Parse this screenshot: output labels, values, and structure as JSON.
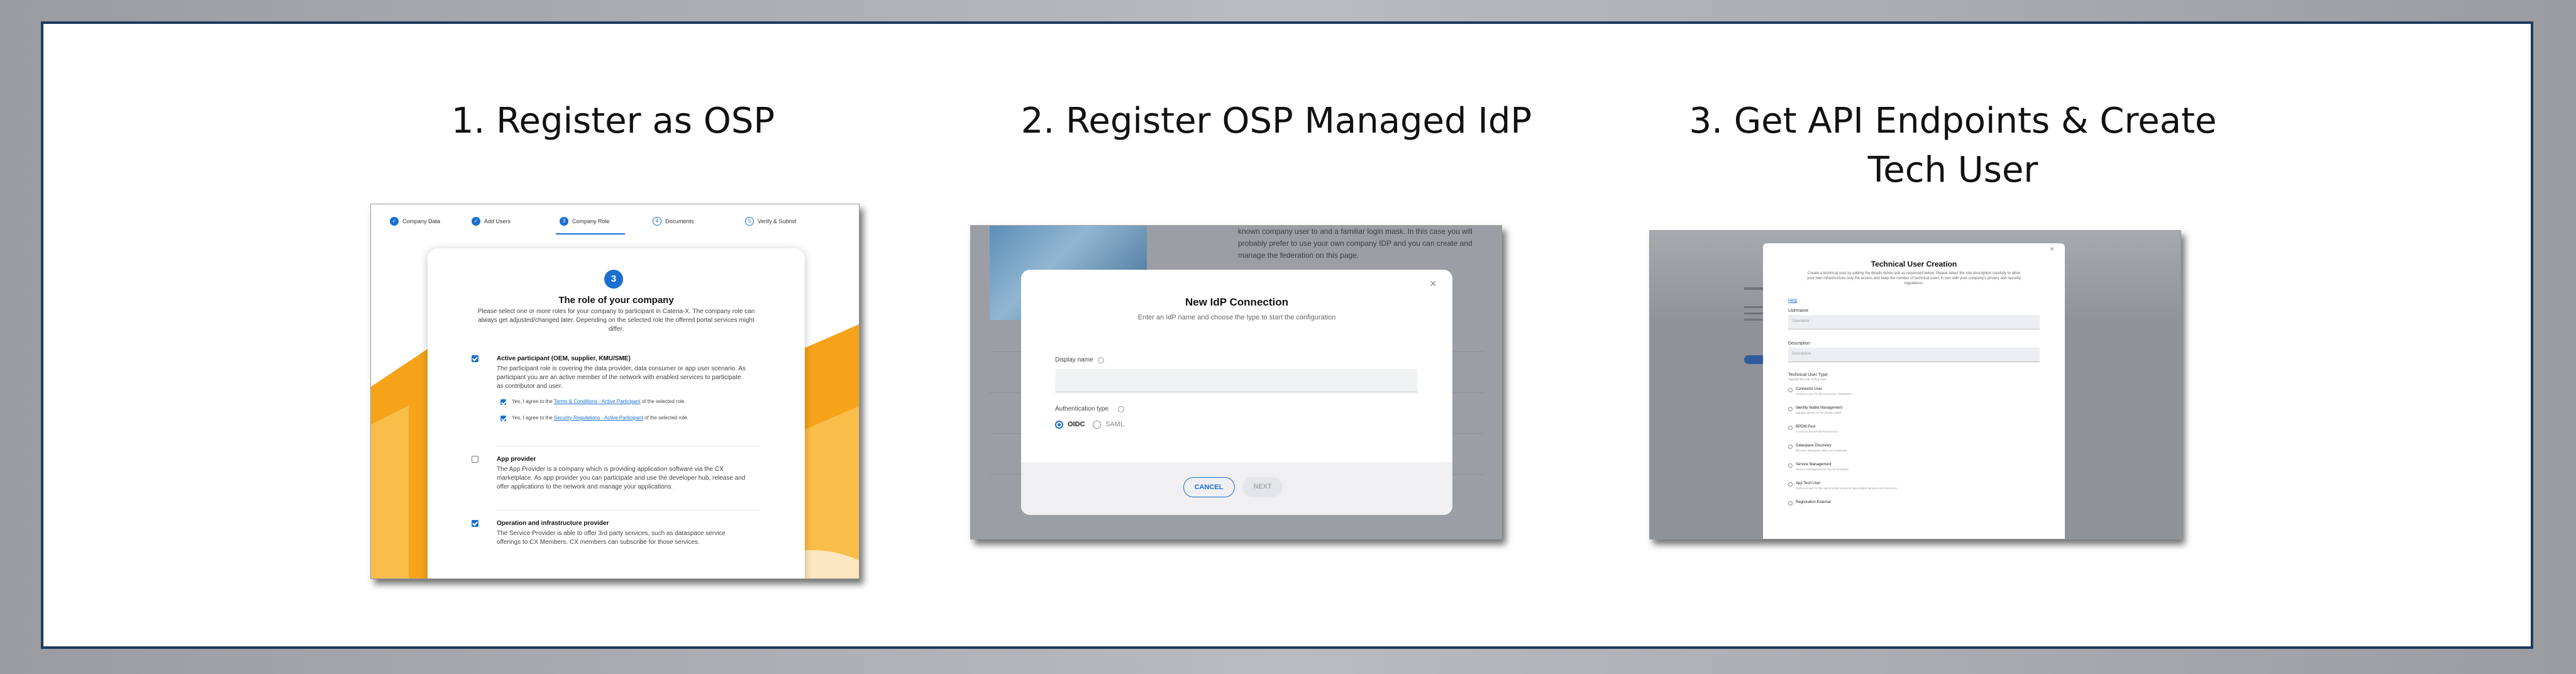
{
  "slide": {
    "step1_title": "1. Register as OSP",
    "step2_title": "2. Register OSP Managed IdP",
    "step3_title_line1": "3. Get API Endpoints & Create",
    "step3_title_line2": "Tech User"
  },
  "shot1": {
    "stepper": [
      {
        "num": "1",
        "label": "Company Data",
        "state": "done"
      },
      {
        "num": "2",
        "label": "Add Users",
        "state": "done"
      },
      {
        "num": "3",
        "label": "Company Role",
        "state": "active"
      },
      {
        "num": "4",
        "label": "Documents",
        "state": "todo"
      },
      {
        "num": "5",
        "label": "Verify & Submit",
        "state": "todo"
      }
    ],
    "badge": "3",
    "heading": "The role of your company",
    "intro": "Please select one or more roles for your company to participant in Catena-X. The company role can always get adjusted/changed later. Depending on the selected role the offered portal services might differ.",
    "roles": [
      {
        "title": "Active participant (OEM, supplier, KMU/SME)",
        "desc": "The participant role is covering the data provider, data consumer or app user scenario. As participant you are an active member of the network with enabled services to participate as contributor and user.",
        "checked": true,
        "agreements": [
          {
            "prefix": "Yes, I agree to the ",
            "link": "Terms & Conditions - Active Participant",
            "suffix": " of the selected role."
          },
          {
            "prefix": "Yes, I agree to the ",
            "link": "Security Regulations - Active Participant",
            "suffix": " of the selected role."
          }
        ]
      },
      {
        "title": "App provider",
        "desc": "The App Provider is a company which is providing application software via the CX marketplace. As app provider you can participate and use the developer hub, release and offer applications to the network and manage your applications.",
        "checked": false,
        "agreements": []
      },
      {
        "title": "Operation and infrastructure provider",
        "desc": "The Service Provider is able to offer 3rd party services, such as dataspace service offerings to CX Members. CX members can subscribe for those services.",
        "checked": true,
        "agreements": []
      }
    ]
  },
  "shot2": {
    "bg_text": "known company user to and a familiar login mask. In this case you will probably prefer to use your own company IDP and you can create and manage the federation on this page.",
    "modal_title": "New IdP Connection",
    "modal_subtitle": "Enter an IdP name and choose the type to start the configuration",
    "display_name_label": "Display name",
    "auth_type_label": "Authentication type",
    "options": [
      {
        "label": "OIDC",
        "selected": true
      },
      {
        "label": "SAML",
        "selected": false
      }
    ],
    "cancel_label": "CANCEL",
    "next_label": "NEXT",
    "close_glyph": "×"
  },
  "shot3": {
    "modal_title": "Technical User Creation",
    "modal_desc": "Create a technical user by adding the details below and as requested below. Please select the role description carefully to allow your own infrastructure only the access and keep the number of technical users in turn with your company's privacy and security regulations.",
    "help_link": "Help",
    "username_label": "Username",
    "username_placeholder": "Username",
    "description_label": "Description",
    "description_placeholder": "Description",
    "type_label": "Technical User Type",
    "type_hint": "Specify the role of this user",
    "types": [
      {
        "label": "Connector User",
        "sub": "Technical user for the connector / Dataspace"
      },
      {
        "label": "Identity Wallet Management",
        "sub": "Manage access to the identity wallet"
      },
      {
        "label": "BPDM Pool",
        "sub": "Access to the BPDM Pool service"
      },
      {
        "label": "Dataspace Discovery",
        "sub": "Discover dataspace offers and endpoints"
      },
      {
        "label": "Service Management",
        "sub": "Service management for service providers"
      },
      {
        "label": "App Tech User",
        "sub": "Technical user for the app provider to access app-related services and resources"
      },
      {
        "label": "Registration External",
        "sub": ""
      }
    ],
    "close_glyph": "×"
  }
}
